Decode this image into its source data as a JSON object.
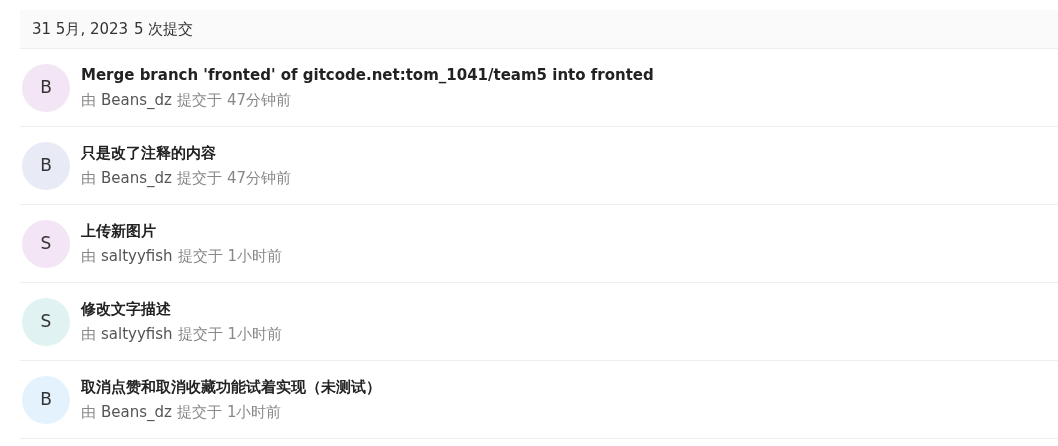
{
  "group": {
    "date": "31 5月, 2023",
    "count": "5 次提交"
  },
  "commits": [
    {
      "avatar": "B",
      "color": "#f3e5f5",
      "title": "Merge branch 'fronted' of gitcode.net:tom_1041/team5 into fronted",
      "by": "由",
      "author": "Beans_dz",
      "action": "提交于",
      "time": "47分钟前"
    },
    {
      "avatar": "B",
      "color": "#e8eaf6",
      "title": "只是改了注释的内容",
      "by": "由",
      "author": "Beans_dz",
      "action": "提交于",
      "time": "47分钟前"
    },
    {
      "avatar": "S",
      "color": "#f3e5f5",
      "title": "上传新图片",
      "by": "由",
      "author": "saltyyfish",
      "action": "提交于",
      "time": "1小时前"
    },
    {
      "avatar": "S",
      "color": "#e0f2f1",
      "title": "修改文字描述",
      "by": "由",
      "author": "saltyyfish",
      "action": "提交于",
      "time": "1小时前"
    },
    {
      "avatar": "B",
      "color": "#e3f2fd",
      "title": "取消点赞和取消收藏功能试着实现（未测试）",
      "by": "由",
      "author": "Beans_dz",
      "action": "提交于",
      "time": "1小时前"
    }
  ]
}
